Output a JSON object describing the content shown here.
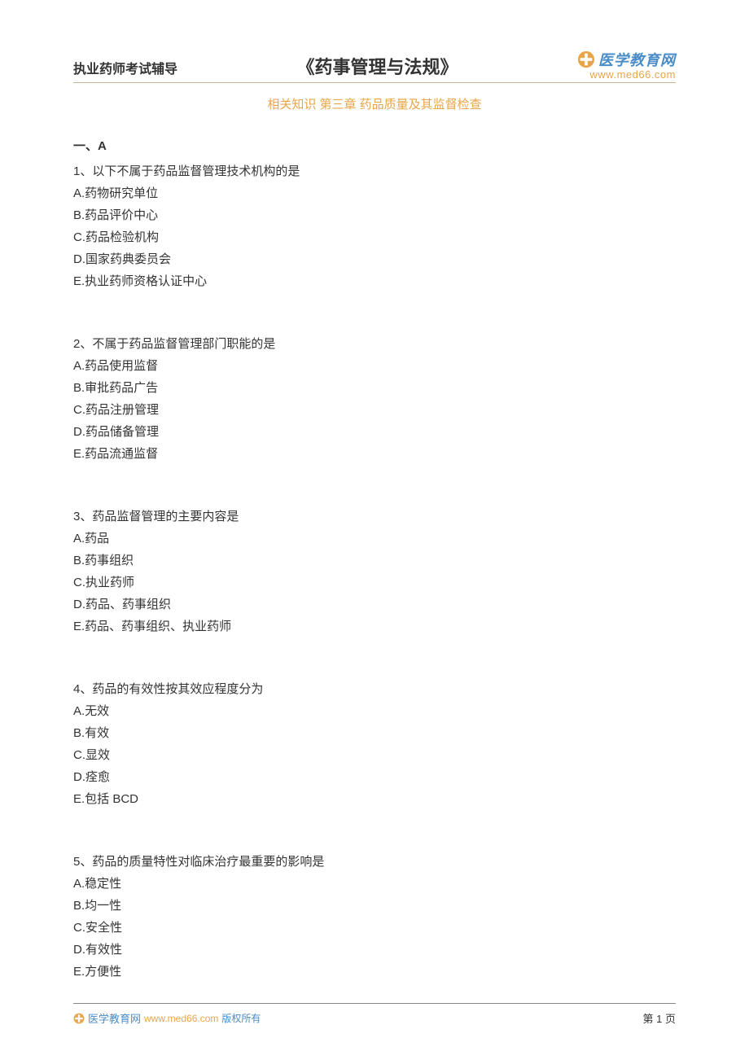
{
  "header": {
    "left": "执业药师考试辅导",
    "center": "《药事管理与法规》",
    "logo_text": "医学教育网",
    "logo_url": "www.med66.com"
  },
  "subtitle": "相关知识 第三章 药品质量及其监督检查",
  "section_label": "一、A",
  "questions": [
    {
      "text": "1、以下不属于药品监督管理技术机构的是",
      "options": [
        "A.药物研究单位",
        "B.药品评价中心",
        "C.药品检验机构",
        "D.国家药典委员会",
        "E.执业药师资格认证中心"
      ]
    },
    {
      "text": "2、不属于药品监督管理部门职能的是",
      "options": [
        "A.药品使用监督",
        "B.审批药品广告",
        "C.药品注册管理",
        "D.药品储备管理",
        "E.药品流通监督"
      ]
    },
    {
      "text": "3、药品监督管理的主要内容是",
      "options": [
        "A.药品",
        "B.药事组织",
        "C.执业药师",
        "D.药品、药事组织",
        "E.药品、药事组织、执业药师"
      ]
    },
    {
      "text": "4、药品的有效性按其效应程度分为",
      "options": [
        "A.无效",
        "B.有效",
        "C.显效",
        "D.痊愈",
        "E.包括 BCD"
      ]
    },
    {
      "text": "5、药品的质量特性对临床治疗最重要的影响是",
      "options": [
        "A.稳定性",
        "B.均一性",
        "C.安全性",
        "D.有效性",
        "E.方便性"
      ]
    }
  ],
  "footer": {
    "brand": "医学教育网",
    "url": "www.med66.com",
    "copyright": "版权所有",
    "page": "第 1 页"
  }
}
